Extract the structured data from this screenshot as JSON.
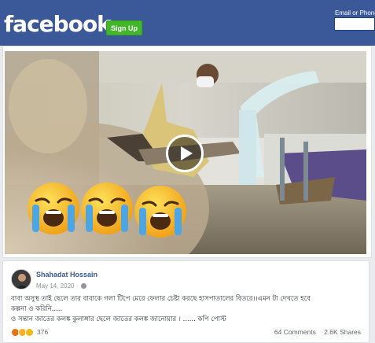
{
  "header": {
    "logo": "facebook",
    "signup_label": "Sign Up",
    "email_label": "Email or Phone",
    "email_value": ""
  },
  "post": {
    "author": "Shahadat Hossain",
    "date": "May 14, 2020 ·",
    "text_line1": "বাবা অসুস্থ তাই ছেলে তার বাবাকে গলা টিপে মেরে ফেলার চেষ্টা করছে হাসপাতালের বিতরে।।এমন টা দেখতে হবে",
    "text_line2": "কল্পনা ও করিনি.....",
    "text_line3": "ও সন্তান জাতের কলঙ্ক কুলাঙ্গার ছেলে জাতের কলঙ্ক জানোয়ার । ...... কপি পোস্ট",
    "reaction_count": "376",
    "comments": "64 Comments",
    "shares": "2.6K Shares"
  },
  "colors": {
    "brand": "#3b5998",
    "signup": "#42b72a",
    "link": "#385898"
  },
  "icons": [
    "play-icon",
    "globe-icon",
    "angry-reaction-icon",
    "haha-reaction-icon",
    "sad-reaction-icon",
    "crying-emoji-icon"
  ]
}
